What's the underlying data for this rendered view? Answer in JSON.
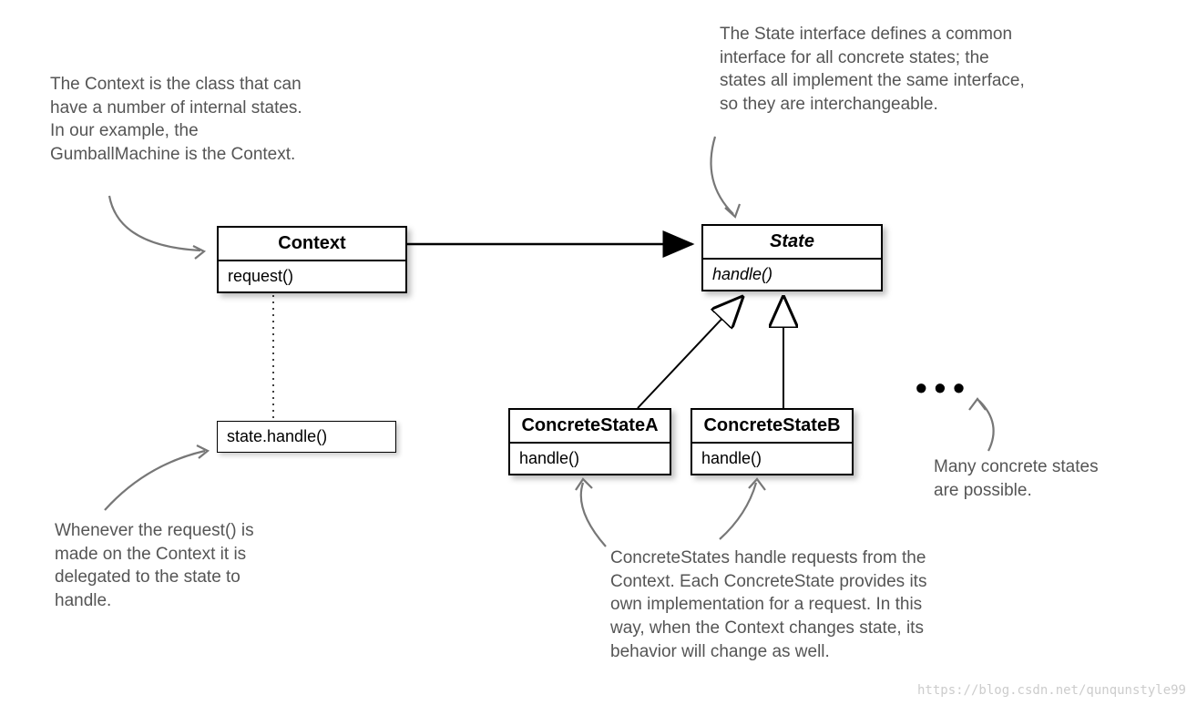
{
  "annotations": {
    "context_note": "The Context is the class that can have a number of internal states.  In our example, the GumballMachine is the Context.",
    "state_note": "The State interface defines a common interface for all concrete states;  the states all implement the same interface, so they are interchangeable.",
    "request_note": "Whenever the request() is made on the Context it is delegated to the state to handle.",
    "concrete_note": "ConcreteStates handle requests from the Context. Each ConcreteState provides its own implementation for a request.  In this way, when the Context changes state, its behavior will change as well.",
    "many_note": "Many concrete states are possible."
  },
  "classes": {
    "context": {
      "name": "Context",
      "method": "request()"
    },
    "state": {
      "name": "State",
      "method": "handle()"
    },
    "concreteA": {
      "name": "ConcreteStateA",
      "method": "handle()"
    },
    "concreteB": {
      "name": "ConcreteStateB",
      "method": "handle()"
    }
  },
  "delegate_code": "state.handle()",
  "ellipsis": "•••",
  "watermark": "https://blog.csdn.net/qunqunstyle99"
}
